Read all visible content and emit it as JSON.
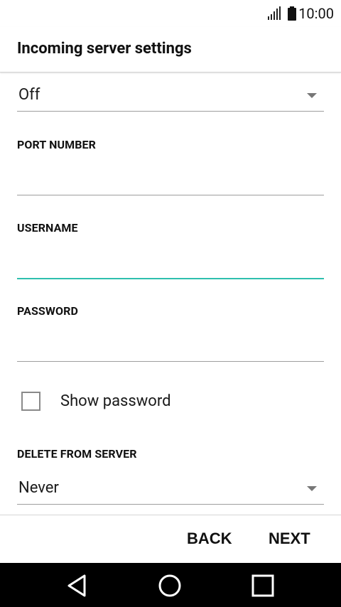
{
  "status_bar": {
    "time": "10:00",
    "icons": [
      "signal-icon",
      "battery-icon"
    ]
  },
  "header": {
    "title": "Incoming server settings"
  },
  "security": {
    "value": "Off"
  },
  "port": {
    "label": "PORT NUMBER",
    "value": "",
    "placeholder": ""
  },
  "username": {
    "label": "USERNAME",
    "value": "",
    "placeholder": ""
  },
  "password": {
    "label": "PASSWORD",
    "value": "",
    "placeholder": ""
  },
  "show_password": {
    "label": "Show password",
    "checked": false
  },
  "delete_from_server": {
    "label": "DELETE FROM SERVER",
    "value": "Never"
  },
  "actions": {
    "back_label": "BACK",
    "next_label": "NEXT"
  },
  "nav": {
    "icons": [
      "back-triangle-icon",
      "home-circle-icon",
      "recents-square-icon"
    ]
  },
  "colors": {
    "focus_accent": "#2fbfae",
    "nav_bar": "#000000"
  }
}
